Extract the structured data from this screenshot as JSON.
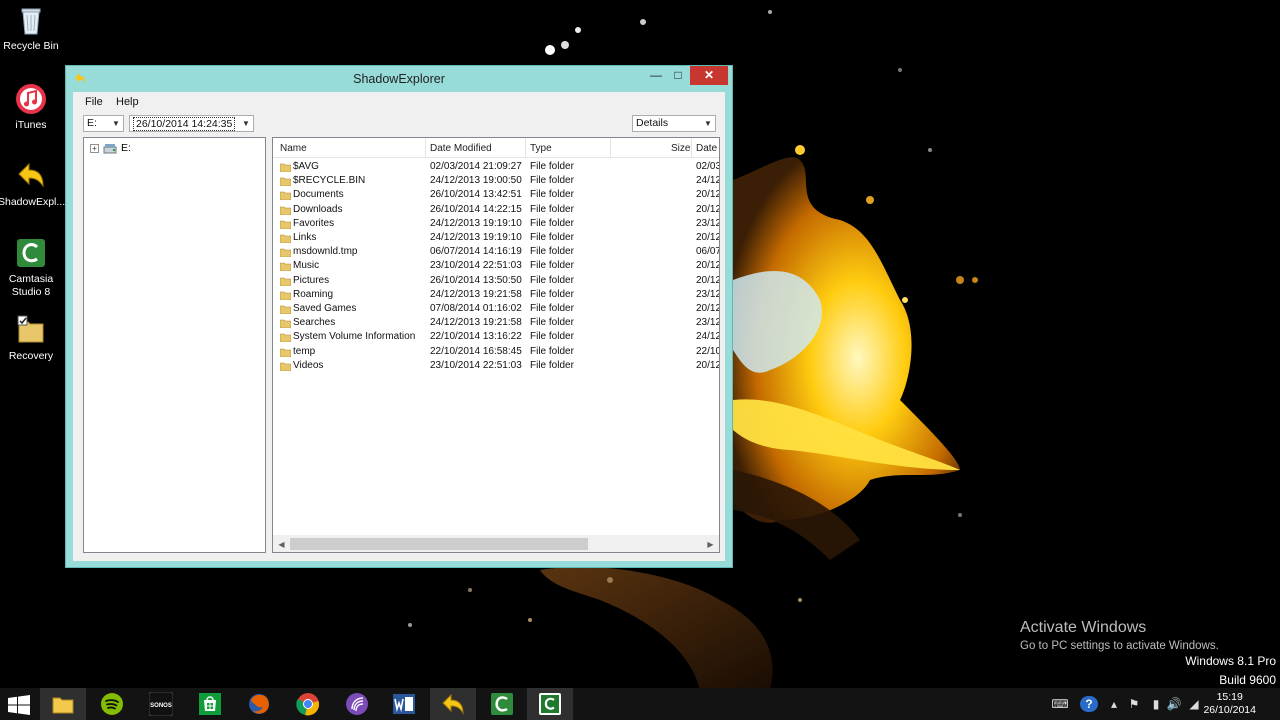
{
  "desktop": {
    "icons": [
      {
        "label": "Recycle Bin"
      },
      {
        "label": "iTunes"
      },
      {
        "label": "ShadowExpl..."
      },
      {
        "label": "Camtasia Studio 8"
      },
      {
        "label": "Recovery"
      }
    ],
    "watermark": {
      "title": "Activate Windows",
      "subtitle": "Go to PC settings to activate Windows."
    },
    "version": {
      "line1": "Windows 8.1 Pro",
      "line2": "Build 9600"
    }
  },
  "window": {
    "title": "ShadowExplorer",
    "menu": {
      "file": "File",
      "help": "Help"
    },
    "drive_select": {
      "value": "E:"
    },
    "snapshot_select": {
      "value": "26/10/2014 14:24:35"
    },
    "view_select": {
      "value": "Details"
    },
    "tree": {
      "root_label": "E:",
      "expander": "+"
    },
    "columns": {
      "name": "Name",
      "date_modified": "Date Modified",
      "type": "Type",
      "size": "Size",
      "date": "Date"
    },
    "rows": [
      {
        "name": "$AVG",
        "modified": "02/03/2014 21:09:27",
        "type": "File folder",
        "date": "02/03"
      },
      {
        "name": "$RECYCLE.BIN",
        "modified": "24/12/2013 19:00:50",
        "type": "File folder",
        "date": "24/12"
      },
      {
        "name": "Documents",
        "modified": "26/10/2014 13:42:51",
        "type": "File folder",
        "date": "20/12"
      },
      {
        "name": "Downloads",
        "modified": "26/10/2014 14:22:15",
        "type": "File folder",
        "date": "20/12"
      },
      {
        "name": "Favorites",
        "modified": "24/12/2013 19:19:10",
        "type": "File folder",
        "date": "23/12"
      },
      {
        "name": "Links",
        "modified": "24/12/2013 19:19:10",
        "type": "File folder",
        "date": "20/12"
      },
      {
        "name": "msdownld.tmp",
        "modified": "06/07/2014 14:16:19",
        "type": "File folder",
        "date": "06/07"
      },
      {
        "name": "Music",
        "modified": "23/10/2014 22:51:03",
        "type": "File folder",
        "date": "20/12"
      },
      {
        "name": "Pictures",
        "modified": "26/10/2014 13:50:50",
        "type": "File folder",
        "date": "20/12"
      },
      {
        "name": "Roaming",
        "modified": "24/12/2013 19:21:58",
        "type": "File folder",
        "date": "23/12"
      },
      {
        "name": "Saved Games",
        "modified": "07/08/2014 01:16:02",
        "type": "File folder",
        "date": "20/12"
      },
      {
        "name": "Searches",
        "modified": "24/12/2013 19:21:58",
        "type": "File folder",
        "date": "23/12"
      },
      {
        "name": "System Volume Information",
        "modified": "22/10/2014 13:16:22",
        "type": "File folder",
        "date": "24/12"
      },
      {
        "name": "temp",
        "modified": "22/10/2014 16:58:45",
        "type": "File folder",
        "date": "22/10"
      },
      {
        "name": "Videos",
        "modified": "23/10/2014 22:51:03",
        "type": "File folder",
        "date": "20/12"
      }
    ]
  },
  "taskbar": {
    "apps": [
      "file-explorer",
      "spotify",
      "sonos",
      "store",
      "firefox",
      "chrome",
      "itunes",
      "word",
      "shadowexplorer",
      "camtasia",
      "camtasia-recorder"
    ],
    "sonos_label": "SONOS",
    "clock": {
      "time": "15:19",
      "date": "26/10/2014"
    }
  },
  "colors": {
    "window_frame": "#97dcd8",
    "close_button": "#c7372f",
    "folder": "#e8c66a"
  }
}
